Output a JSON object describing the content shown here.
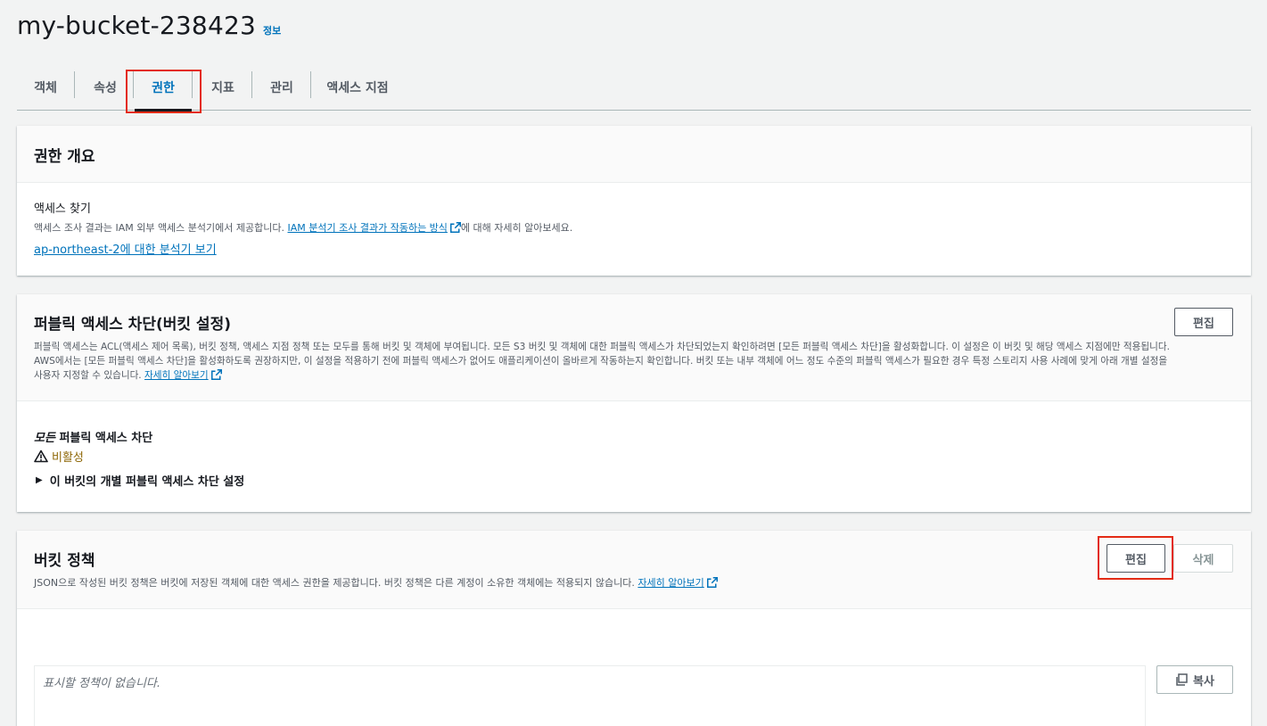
{
  "header": {
    "title": "my-bucket-238423",
    "info_link": "정보"
  },
  "tabs": [
    {
      "label": "객체"
    },
    {
      "label": "속성"
    },
    {
      "label": "권한"
    },
    {
      "label": "지표"
    },
    {
      "label": "관리"
    },
    {
      "label": "액세스 지점"
    }
  ],
  "access_overview": {
    "title": "권한 개요",
    "subtitle": "액세스 찾기",
    "desc_prefix": "액세스 조사 결과는 IAM 외부 액세스 분석기에서 제공합니다. ",
    "desc_link": "IAM 분석기 조사 결과가 작동하는 방식",
    "desc_suffix": "에 대해 자세히 알아보세요.",
    "analyzer_link": "ap-northeast-2에 대한 분석기 보기"
  },
  "block_public_access": {
    "title": "퍼블릭 액세스 차단(버킷 설정)",
    "edit_label": "편집",
    "desc_line1": "퍼블릭 액세스는 ACL(액세스 제어 목록), 버킷 정책, 액세스 지점 정책 또는 모두를 통해 버킷 및 객체에 부여됩니다. 모든 S3 버킷 및 객체에 대한 퍼블릭 액세스가 차단되었는지 확인하려면 [모든 퍼블릭 액세스 차단]을 활성화합니다. 이 설정은 이 버킷 및 해당 액세스 지점에만 적용됩니다.",
    "desc_line2": "AWS에서는 [모든 퍼블릭 액세스 차단]을 활성화하도록 권장하지만, 이 설정을 적용하기 전에 퍼블릭 액세스가 없어도 애플리케이션이 올바르게 작동하는지 확인합니다. 버킷 또는 내부 객체에 어느 정도 수준의 퍼블릭 액세스가 필요한 경우 특정 스토리지 사용 사례에 맞게 아래 개별 설정을",
    "desc_line3": "사용자 지정할 수 있습니다. ",
    "learn_more": "자세히 알아보기",
    "block_all_italic": "모든",
    "block_all_rest": " 퍼블릭 액세스 차단",
    "status": "비활성",
    "status_color": "#8d6605",
    "expander": "이 버킷의 개별 퍼블릭 액세스 차단 설정"
  },
  "bucket_policy": {
    "title": "버킷 정책",
    "desc": "JSON으로 작성된 버킷 정책은 버킷에 저장된 객체에 대한 액세스 권한을 제공합니다. 버킷 정책은 다른 계정이 소유한 객체에는 적용되지 않습니다. ",
    "learn_more": "자세히 알아보기",
    "edit_label": "편집",
    "delete_label": "삭제",
    "empty_text": "표시할 정책이 없습니다.",
    "copy_label": "복사"
  },
  "colors": {
    "link": "#0073bb",
    "highlight": "#e32b15",
    "warning": "#8d6605"
  }
}
